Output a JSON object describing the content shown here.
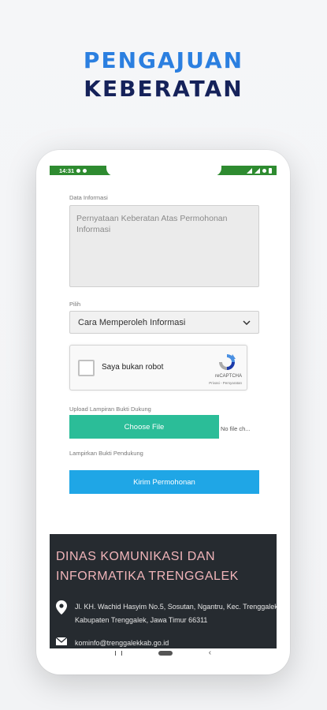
{
  "headline": {
    "line1": "PENGAJUAN",
    "line2": "KEBERATAN"
  },
  "status_bar": {
    "time": "14:31"
  },
  "form": {
    "data_label": "Data Informasi",
    "textarea_text": "Pernyataan Keberatan Atas Permohonan Informasi",
    "pilih_label": "Pilih",
    "select_value": "Cara Memperoleh Informasi",
    "recaptcha": {
      "checkbox_label": "Saya bukan robot",
      "brand": "reCAPTCHA",
      "links": "Privasi - Persyaratan"
    },
    "upload_label": "Upload Lampiran Bukti Dukung",
    "choose_file": "Choose File",
    "no_file": "No file ch...",
    "lampirkan_label": "Lampirkan Bukti Pendukung",
    "submit": "Kirim Permohonan"
  },
  "footer": {
    "title": "DINAS KOMUNIKASI DAN INFORMATIKA TRENGGALEK",
    "address": "Jl. KH. Wachid Hasyim No.5, Sosutan, Ngantru, Kec. Trenggalek, Kabupaten Trenggalek, Jawa Timur 66311",
    "email": "kominfo@trenggalekkab.go.id"
  },
  "colors": {
    "status_bar": "#2e8b30",
    "headline_blue": "#2b7fe0",
    "headline_navy": "#15225a",
    "choose_button": "#2bbd98",
    "submit_button": "#1fa6e6",
    "footer_bg": "#262b30",
    "footer_title": "#f0b4b9"
  }
}
